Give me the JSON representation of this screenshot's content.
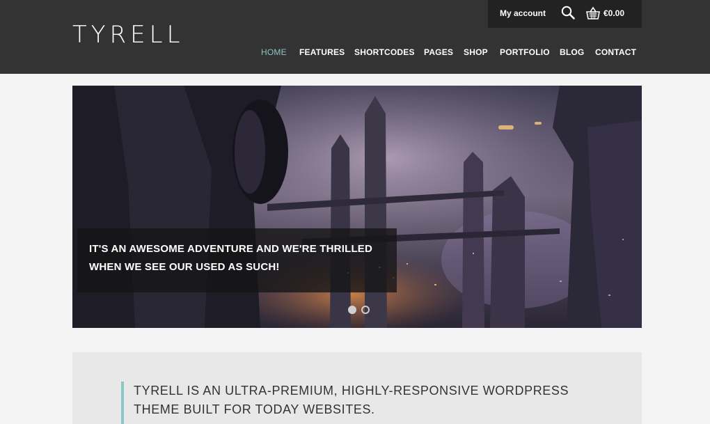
{
  "header": {
    "logo": "TYRELL",
    "account_label": "My account",
    "cart_total": "€0.00",
    "search_icon": "search-icon",
    "cart_icon": "basket-icon"
  },
  "nav": {
    "items": [
      {
        "label": "HOME",
        "active": true
      },
      {
        "label": "FEATURES"
      },
      {
        "label": "SHORTCODES"
      },
      {
        "label": "PAGES"
      },
      {
        "label": "SHOP"
      },
      {
        "label": "PORTFOLIO"
      },
      {
        "label": "BLOG"
      },
      {
        "label": "CONTACT"
      }
    ]
  },
  "slider": {
    "caption_line1": "IT'S AN AWESOME ADVENTURE AND WE'RE THRILLED",
    "caption_line2": "WHEN WE SEE OUR USED AS SUCH!",
    "slide_count": 2,
    "active_slide": 1
  },
  "intro": {
    "line1": "TYRELL IS AN ULTRA-PREMIUM, HIGHLY-RESPONSIVE WORDPRESS",
    "line2": "THEME BUILT FOR TODAY WEBSITES."
  },
  "colors": {
    "header_bg": "#333333",
    "topbar_bg": "#222222",
    "accent": "#8ec6c2",
    "page_bg": "#f4f4f4"
  }
}
